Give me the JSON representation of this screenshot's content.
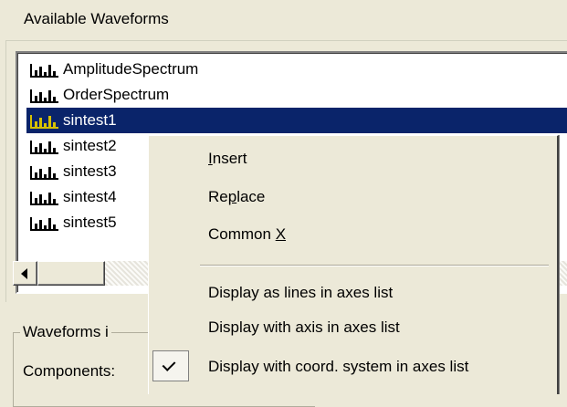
{
  "panel": {
    "title": "Available Waveforms",
    "list_items": [
      {
        "label": "AmplitudeSpectrum",
        "icon": "waveform-icon",
        "selected": false
      },
      {
        "label": "OrderSpectrum",
        "icon": "waveform-icon",
        "selected": false
      },
      {
        "label": "sintest1",
        "icon": "waveform-icon",
        "selected": true
      },
      {
        "label": "sintest2",
        "icon": "waveform-icon",
        "selected": false
      },
      {
        "label": "sintest3",
        "icon": "waveform-icon",
        "selected": false
      },
      {
        "label": "sintest4",
        "icon": "waveform-icon",
        "selected": false
      },
      {
        "label": "sintest5",
        "icon": "waveform-icon",
        "selected": false
      }
    ],
    "group_legend": "Waveforms i",
    "components_label": "Components:"
  },
  "context_menu": {
    "insert": {
      "pre": "",
      "key": "I",
      "post": "nsert"
    },
    "replace": {
      "pre": "Re",
      "key": "p",
      "post": "lace"
    },
    "common_x": {
      "pre": "Common ",
      "key": "X",
      "post": ""
    },
    "display_lines": "Display as lines in axes list",
    "display_axis": "Display with axis in axes list",
    "display_coord": "Display with coord. system in axes list",
    "checked_item": "display_coord"
  },
  "colors": {
    "selection": "#0a246a",
    "window_bg": "#ece9d8",
    "icon_yellow": "#d7c100"
  }
}
